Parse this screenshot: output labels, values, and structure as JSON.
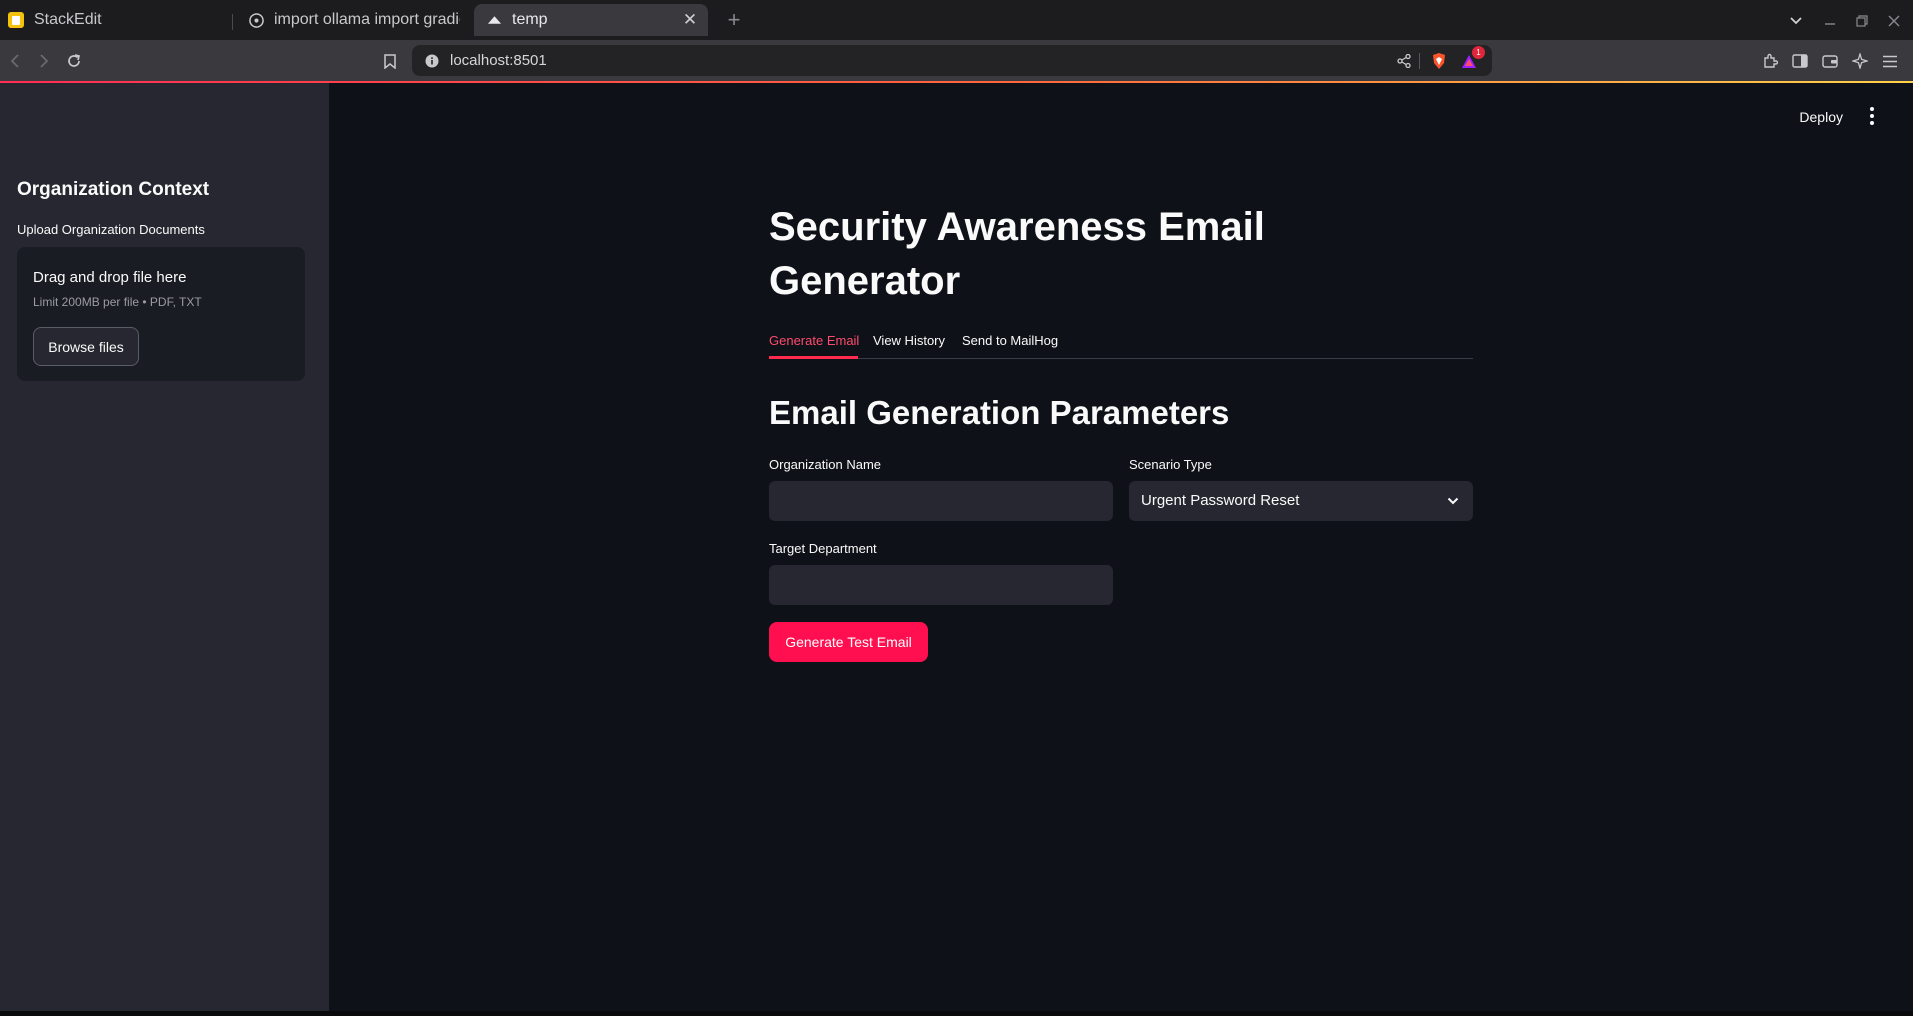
{
  "browser": {
    "tabs": [
      {
        "title": "StackEdit",
        "favicon": "stackedit-icon"
      },
      {
        "title": "import ollama import gradio",
        "favicon": "github-icon"
      },
      {
        "title": "temp",
        "favicon": "streamlit-icon",
        "active": true
      }
    ],
    "url": "localhost:8501",
    "brave_badge_count": "1"
  },
  "sidebar": {
    "title": "Organization Context",
    "upload_label": "Upload Organization Documents",
    "dropzone_title": "Drag and drop file here",
    "dropzone_limit": "Limit 200MB per file • PDF, TXT",
    "browse_button": "Browse files"
  },
  "header": {
    "deploy": "Deploy"
  },
  "main": {
    "title": "Security Awareness Email Generator",
    "tabs": [
      {
        "label": "Generate Email",
        "active": true
      },
      {
        "label": "View History"
      },
      {
        "label": "Send to MailHog"
      }
    ],
    "section_title": "Email Generation Parameters",
    "org_name_label": "Organization Name",
    "org_name_value": "",
    "scenario_label": "Scenario Type",
    "scenario_value": "Urgent Password Reset",
    "department_label": "Target Department",
    "department_value": "",
    "generate_button": "Generate Test Email"
  },
  "colors": {
    "accent": "#ff2b4e",
    "button": "#ff0f4f",
    "background": "#0e1117",
    "sidebar": "#262730"
  }
}
